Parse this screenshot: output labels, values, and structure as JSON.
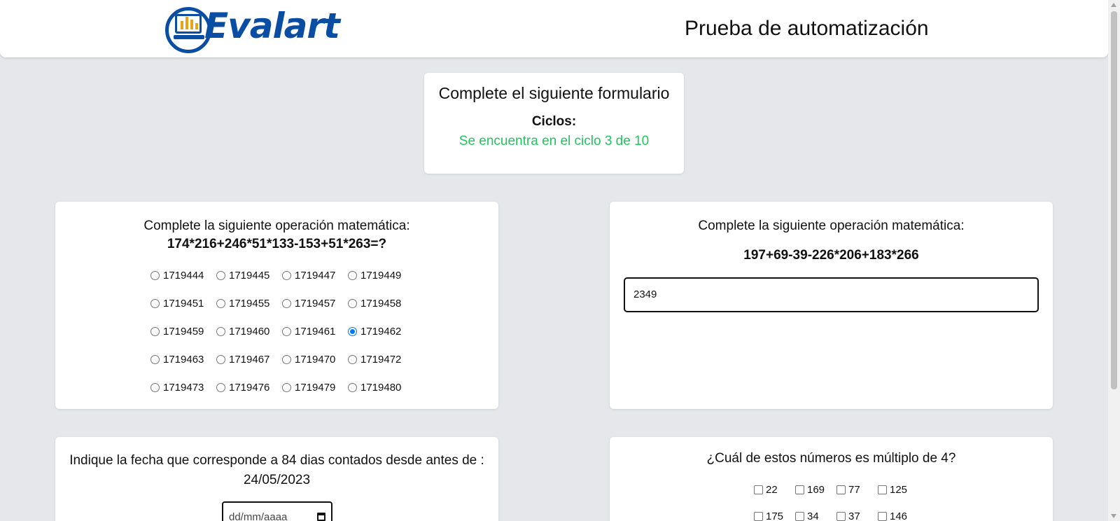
{
  "header": {
    "logo_text": "Evalart",
    "title": "Prueba de automatización"
  },
  "status_card": {
    "title": "Complete el siguiente formulario",
    "cycles_label": "Ciclos:",
    "cycles_text": "Se encuentra en el ciclo 3 de 10",
    "cycles_color": "#22c55e"
  },
  "question1": {
    "prompt": "Complete la siguiente operación matemática:",
    "operation": "174*216+246*51*133-153+51*263=?",
    "options": [
      "1719444",
      "1719445",
      "1719447",
      "1719449",
      "1719451",
      "1719455",
      "1719457",
      "1719458",
      "1719459",
      "1719460",
      "1719461",
      "1719462",
      "1719463",
      "1719467",
      "1719470",
      "1719472",
      "1719473",
      "1719476",
      "1719479",
      "1719480"
    ],
    "selected": "1719462"
  },
  "question2": {
    "prompt": "Complete la siguiente operación matemática:",
    "operation": "197+69-39-226*206+183*266",
    "value": "2349"
  },
  "question3": {
    "prompt": "Indique la fecha que corresponde a 84 dias contados desde antes de : 24/05/2023",
    "placeholder": "dd/mm/aaaa"
  },
  "question4": {
    "prompt": "¿Cuál de estos números es múltiplo de 4?",
    "options": [
      "22",
      "169",
      "77",
      "125",
      "175",
      "34",
      "37",
      "146"
    ]
  }
}
